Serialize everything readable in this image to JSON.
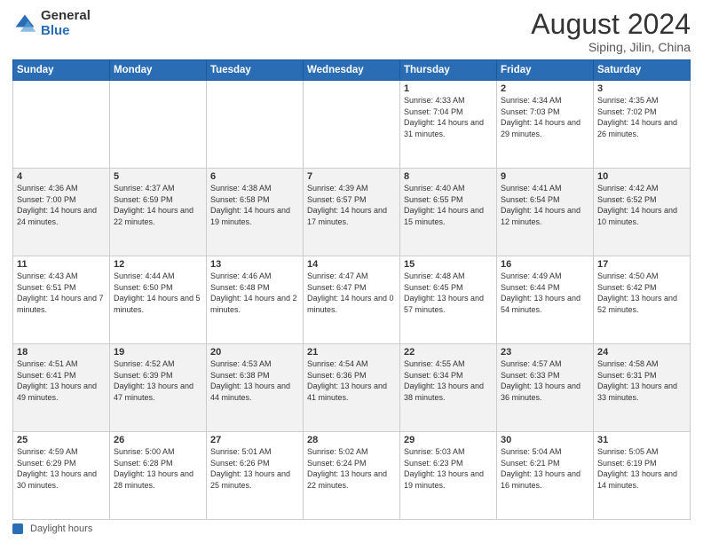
{
  "logo": {
    "general": "General",
    "blue": "Blue"
  },
  "title": "August 2024",
  "location": "Siping, Jilin, China",
  "days_header": [
    "Sunday",
    "Monday",
    "Tuesday",
    "Wednesday",
    "Thursday",
    "Friday",
    "Saturday"
  ],
  "footer_label": "Daylight hours",
  "weeks": [
    [
      {
        "num": "",
        "info": ""
      },
      {
        "num": "",
        "info": ""
      },
      {
        "num": "",
        "info": ""
      },
      {
        "num": "",
        "info": ""
      },
      {
        "num": "1",
        "info": "Sunrise: 4:33 AM\nSunset: 7:04 PM\nDaylight: 14 hours\nand 31 minutes."
      },
      {
        "num": "2",
        "info": "Sunrise: 4:34 AM\nSunset: 7:03 PM\nDaylight: 14 hours\nand 29 minutes."
      },
      {
        "num": "3",
        "info": "Sunrise: 4:35 AM\nSunset: 7:02 PM\nDaylight: 14 hours\nand 26 minutes."
      }
    ],
    [
      {
        "num": "4",
        "info": "Sunrise: 4:36 AM\nSunset: 7:00 PM\nDaylight: 14 hours\nand 24 minutes."
      },
      {
        "num": "5",
        "info": "Sunrise: 4:37 AM\nSunset: 6:59 PM\nDaylight: 14 hours\nand 22 minutes."
      },
      {
        "num": "6",
        "info": "Sunrise: 4:38 AM\nSunset: 6:58 PM\nDaylight: 14 hours\nand 19 minutes."
      },
      {
        "num": "7",
        "info": "Sunrise: 4:39 AM\nSunset: 6:57 PM\nDaylight: 14 hours\nand 17 minutes."
      },
      {
        "num": "8",
        "info": "Sunrise: 4:40 AM\nSunset: 6:55 PM\nDaylight: 14 hours\nand 15 minutes."
      },
      {
        "num": "9",
        "info": "Sunrise: 4:41 AM\nSunset: 6:54 PM\nDaylight: 14 hours\nand 12 minutes."
      },
      {
        "num": "10",
        "info": "Sunrise: 4:42 AM\nSunset: 6:52 PM\nDaylight: 14 hours\nand 10 minutes."
      }
    ],
    [
      {
        "num": "11",
        "info": "Sunrise: 4:43 AM\nSunset: 6:51 PM\nDaylight: 14 hours\nand 7 minutes."
      },
      {
        "num": "12",
        "info": "Sunrise: 4:44 AM\nSunset: 6:50 PM\nDaylight: 14 hours\nand 5 minutes."
      },
      {
        "num": "13",
        "info": "Sunrise: 4:46 AM\nSunset: 6:48 PM\nDaylight: 14 hours\nand 2 minutes."
      },
      {
        "num": "14",
        "info": "Sunrise: 4:47 AM\nSunset: 6:47 PM\nDaylight: 14 hours\nand 0 minutes."
      },
      {
        "num": "15",
        "info": "Sunrise: 4:48 AM\nSunset: 6:45 PM\nDaylight: 13 hours\nand 57 minutes."
      },
      {
        "num": "16",
        "info": "Sunrise: 4:49 AM\nSunset: 6:44 PM\nDaylight: 13 hours\nand 54 minutes."
      },
      {
        "num": "17",
        "info": "Sunrise: 4:50 AM\nSunset: 6:42 PM\nDaylight: 13 hours\nand 52 minutes."
      }
    ],
    [
      {
        "num": "18",
        "info": "Sunrise: 4:51 AM\nSunset: 6:41 PM\nDaylight: 13 hours\nand 49 minutes."
      },
      {
        "num": "19",
        "info": "Sunrise: 4:52 AM\nSunset: 6:39 PM\nDaylight: 13 hours\nand 47 minutes."
      },
      {
        "num": "20",
        "info": "Sunrise: 4:53 AM\nSunset: 6:38 PM\nDaylight: 13 hours\nand 44 minutes."
      },
      {
        "num": "21",
        "info": "Sunrise: 4:54 AM\nSunset: 6:36 PM\nDaylight: 13 hours\nand 41 minutes."
      },
      {
        "num": "22",
        "info": "Sunrise: 4:55 AM\nSunset: 6:34 PM\nDaylight: 13 hours\nand 38 minutes."
      },
      {
        "num": "23",
        "info": "Sunrise: 4:57 AM\nSunset: 6:33 PM\nDaylight: 13 hours\nand 36 minutes."
      },
      {
        "num": "24",
        "info": "Sunrise: 4:58 AM\nSunset: 6:31 PM\nDaylight: 13 hours\nand 33 minutes."
      }
    ],
    [
      {
        "num": "25",
        "info": "Sunrise: 4:59 AM\nSunset: 6:29 PM\nDaylight: 13 hours\nand 30 minutes."
      },
      {
        "num": "26",
        "info": "Sunrise: 5:00 AM\nSunset: 6:28 PM\nDaylight: 13 hours\nand 28 minutes."
      },
      {
        "num": "27",
        "info": "Sunrise: 5:01 AM\nSunset: 6:26 PM\nDaylight: 13 hours\nand 25 minutes."
      },
      {
        "num": "28",
        "info": "Sunrise: 5:02 AM\nSunset: 6:24 PM\nDaylight: 13 hours\nand 22 minutes."
      },
      {
        "num": "29",
        "info": "Sunrise: 5:03 AM\nSunset: 6:23 PM\nDaylight: 13 hours\nand 19 minutes."
      },
      {
        "num": "30",
        "info": "Sunrise: 5:04 AM\nSunset: 6:21 PM\nDaylight: 13 hours\nand 16 minutes."
      },
      {
        "num": "31",
        "info": "Sunrise: 5:05 AM\nSunset: 6:19 PM\nDaylight: 13 hours\nand 14 minutes."
      }
    ]
  ]
}
